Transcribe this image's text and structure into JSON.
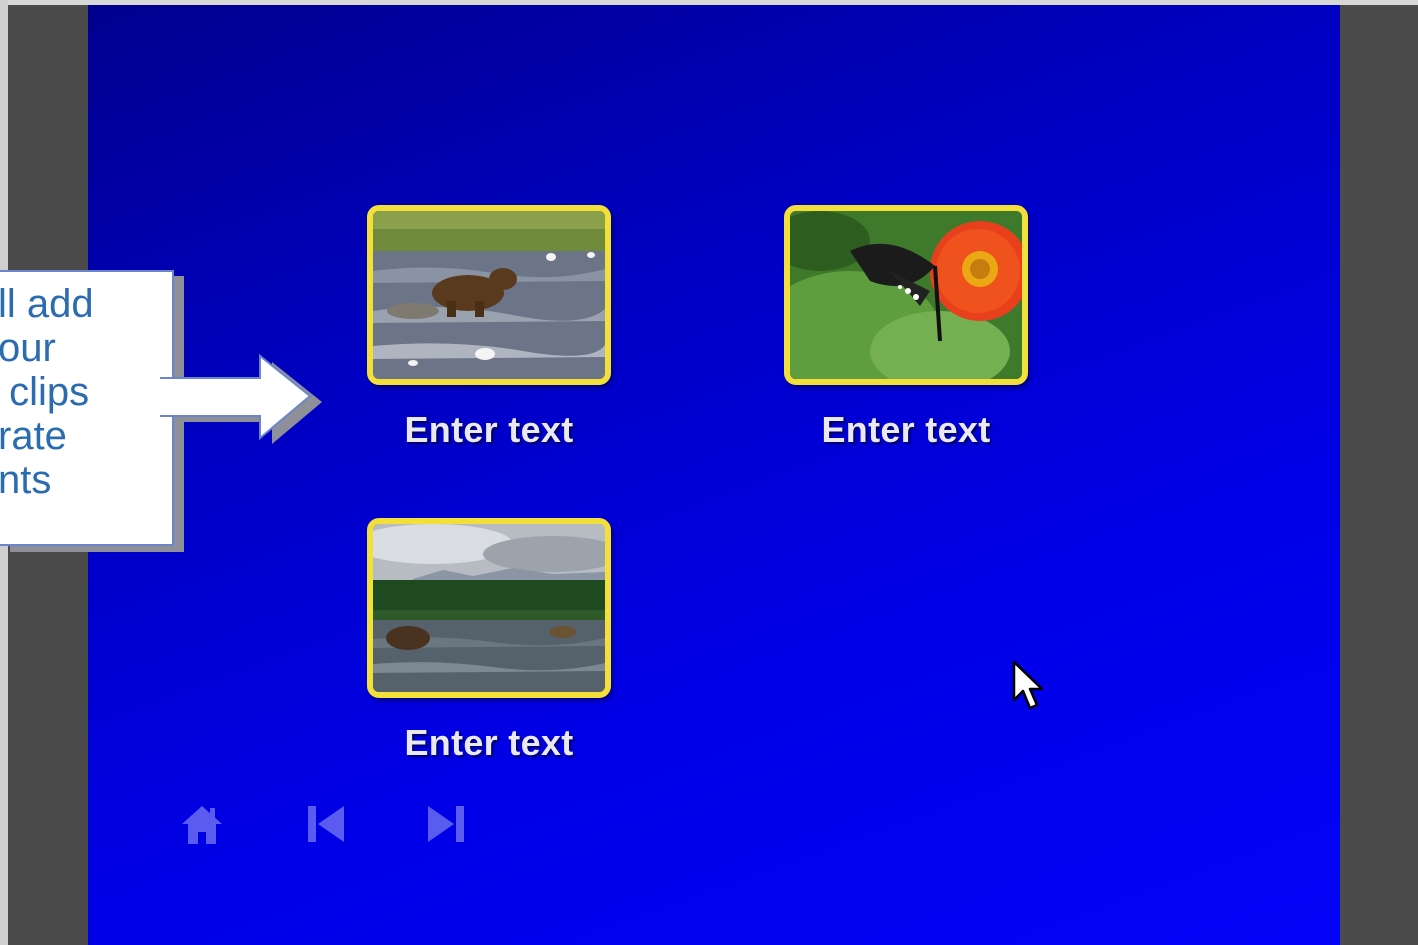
{
  "menu": {
    "items": [
      {
        "label": "Enter text",
        "thumbnail": "bear-in-river-image"
      },
      {
        "label": "Enter text",
        "thumbnail": "butterfly-on-flower-image"
      },
      {
        "label": "Enter text",
        "thumbnail": "lake-landscape-image"
      }
    ]
  },
  "navigation": {
    "home_icon": "home-icon",
    "previous_icon": "skip-previous-icon",
    "next_icon": "skip-next-icon"
  },
  "callout": {
    "text": "ll add\nour\n clips\nrate\nnts"
  },
  "colors": {
    "background_blue": "#0000e6",
    "thumbnail_border": "#f2df3a",
    "nav_icon": "#5a5cf0",
    "callout_text": "#2b6cb0"
  }
}
